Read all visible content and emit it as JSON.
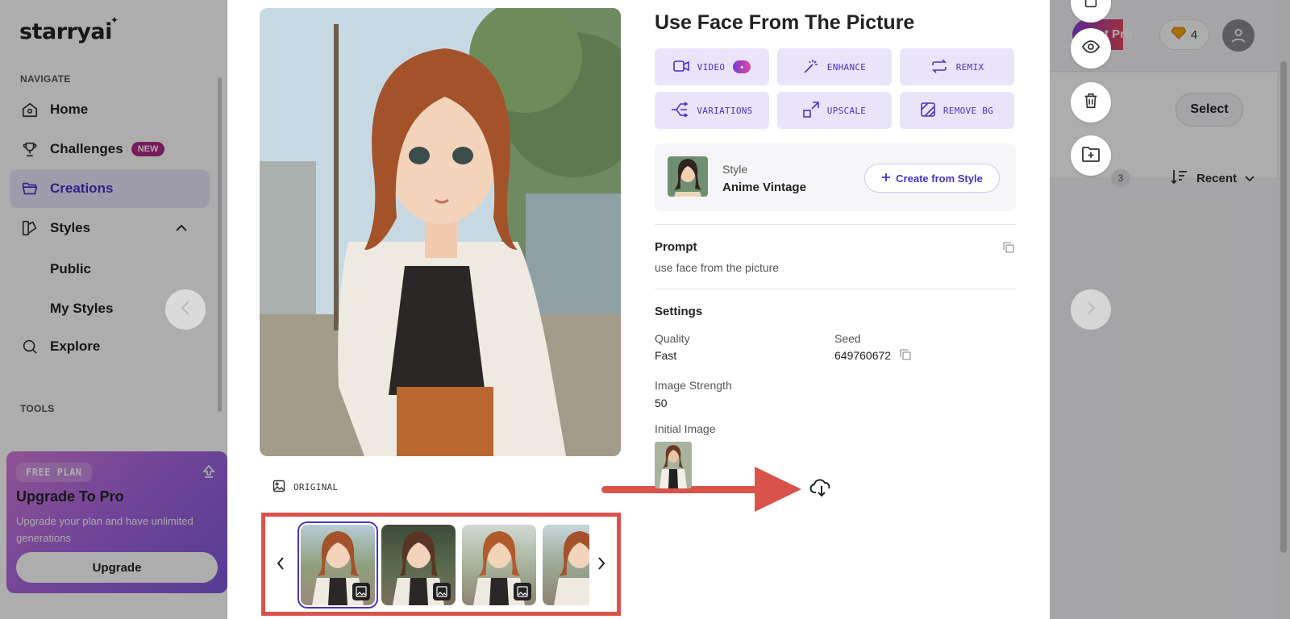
{
  "app": {
    "logo": "starryai",
    "nav_label": "NAVIGATE",
    "tools_label": "TOOLS",
    "nav": [
      {
        "label": "Home"
      },
      {
        "label": "Challenges",
        "badge": "NEW"
      },
      {
        "label": "Creations"
      },
      {
        "label": "Styles"
      },
      {
        "label": "Public"
      },
      {
        "label": "My Styles"
      },
      {
        "label": "Explore"
      }
    ],
    "promo": {
      "plan": "FREE PLAN",
      "title": "Upgrade To Pro",
      "desc": "Upgrade your plan and have unlimited generations",
      "button": "Upgrade"
    },
    "header": {
      "get_pro": "Get Pro",
      "credits": "4"
    },
    "toolbar": {
      "select": "Select",
      "count": "3",
      "sort": "Recent"
    }
  },
  "modal": {
    "title": "Use Face From The Picture",
    "actions": [
      {
        "label": "VIDEO",
        "icon": "video-icon"
      },
      {
        "label": "ENHANCE",
        "icon": "magic-wand-icon"
      },
      {
        "label": "REMIX",
        "icon": "remix-icon"
      },
      {
        "label": "VARIATIONS",
        "icon": "variations-icon"
      },
      {
        "label": "UPSCALE",
        "icon": "upscale-icon"
      },
      {
        "label": "REMOVE BG",
        "icon": "remove-bg-icon"
      }
    ],
    "style": {
      "label": "Style",
      "name": "Anime Vintage",
      "create_button": "Create from Style"
    },
    "prompt": {
      "heading": "Prompt",
      "text": "use face from the picture"
    },
    "settings": {
      "heading": "Settings",
      "quality_label": "Quality",
      "quality_value": "Fast",
      "seed_label": "Seed",
      "seed_value": "649760672",
      "strength_label": "Image Strength",
      "strength_value": "50",
      "initial_label": "Initial Image"
    },
    "original_label": "ORIGINAL"
  },
  "colors": {
    "accent": "#4b30c9",
    "accent_bg": "#eae4fb",
    "annotation": "#d9534a"
  }
}
